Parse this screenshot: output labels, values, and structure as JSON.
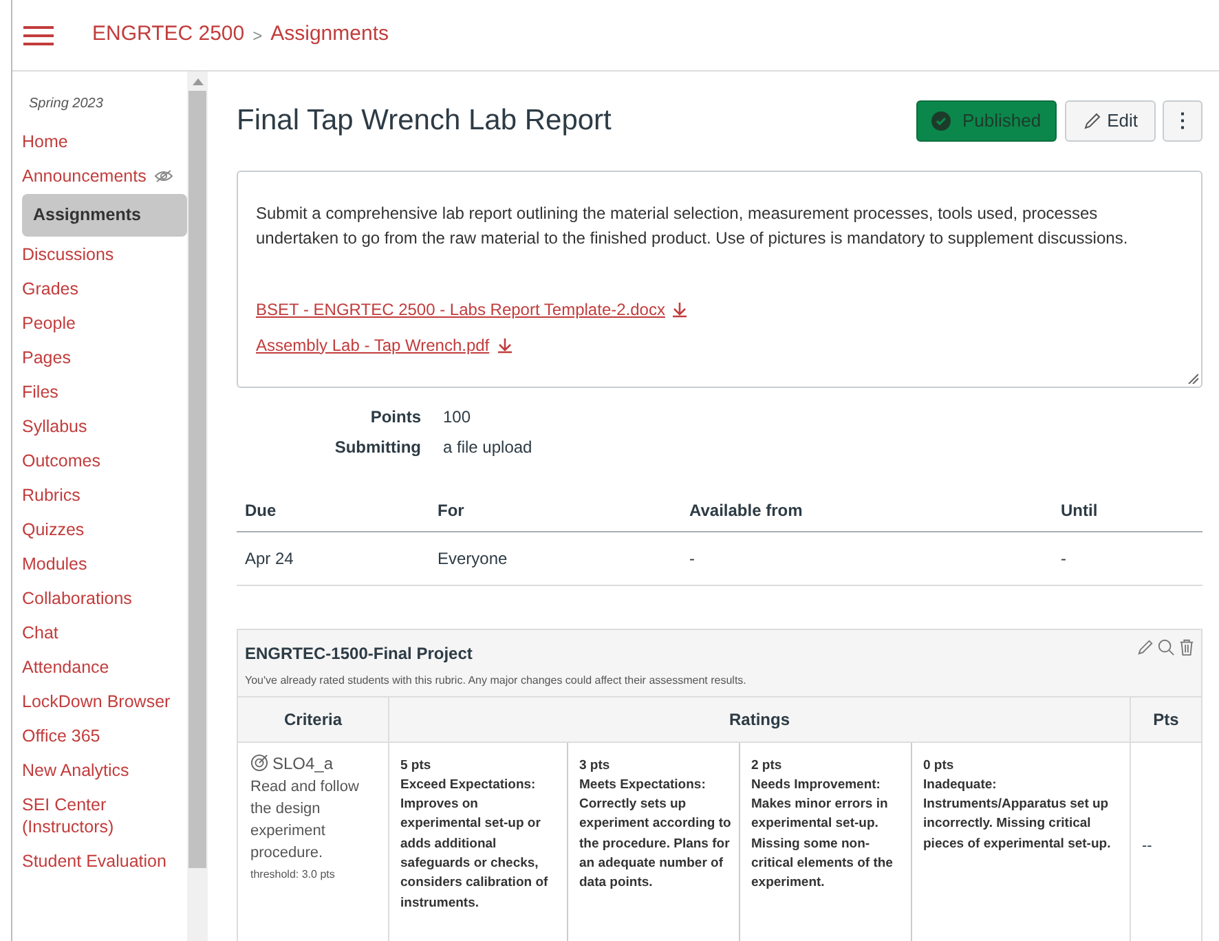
{
  "header": {
    "breadcrumb": [
      "ENGRTEC 2500",
      "Assignments"
    ],
    "separator": ">"
  },
  "sidebar": {
    "term": "Spring 2023",
    "items": [
      {
        "label": "Home",
        "selected": false,
        "hidden": false
      },
      {
        "label": "Announcements",
        "selected": false,
        "hidden": true
      },
      {
        "label": "Assignments",
        "selected": true,
        "hidden": false
      },
      {
        "label": "Discussions",
        "selected": false,
        "hidden": false
      },
      {
        "label": "Grades",
        "selected": false,
        "hidden": false
      },
      {
        "label": "People",
        "selected": false,
        "hidden": false
      },
      {
        "label": "Pages",
        "selected": false,
        "hidden": false
      },
      {
        "label": "Files",
        "selected": false,
        "hidden": false
      },
      {
        "label": "Syllabus",
        "selected": false,
        "hidden": false
      },
      {
        "label": "Outcomes",
        "selected": false,
        "hidden": false
      },
      {
        "label": "Rubrics",
        "selected": false,
        "hidden": false
      },
      {
        "label": "Quizzes",
        "selected": false,
        "hidden": false
      },
      {
        "label": "Modules",
        "selected": false,
        "hidden": false
      },
      {
        "label": "Collaborations",
        "selected": false,
        "hidden": false
      },
      {
        "label": "Chat",
        "selected": false,
        "hidden": false
      },
      {
        "label": "Attendance",
        "selected": false,
        "hidden": false
      },
      {
        "label": "LockDown Browser",
        "selected": false,
        "hidden": false
      },
      {
        "label": "Office 365",
        "selected": false,
        "hidden": false
      },
      {
        "label": "New Analytics",
        "selected": false,
        "hidden": false
      },
      {
        "label": "SEI Center (Instructors)",
        "selected": false,
        "hidden": false
      },
      {
        "label": "Student Evaluation",
        "selected": false,
        "hidden": false
      }
    ]
  },
  "assignment": {
    "title": "Final Tap Wrench Lab Report",
    "published_button": "Published",
    "edit_button": "Edit",
    "more_button": "⋮",
    "description": "Submit a comprehensive lab report outlining the material selection, measurement processes, tools used, processes undertaken to go from the raw material to the finished product. Use of pictures is mandatory to supplement discussions.",
    "attachments": [
      "BSET - ENGRTEC 2500 - Labs Report Template-2.docx",
      "Assembly Lab - Tap Wrench.pdf"
    ],
    "details": [
      {
        "label": "Points",
        "value": "100"
      },
      {
        "label": "Submitting",
        "value": "a file upload"
      }
    ]
  },
  "dates_table": {
    "columns": [
      "Due",
      "For",
      "Available from",
      "Until"
    ],
    "rows": [
      [
        "Apr 24",
        "Everyone",
        "-",
        "-"
      ]
    ]
  },
  "rubric": {
    "title": "ENGRTEC-1500-Final Project",
    "note": "You've already rated students with this rubric. Any major changes could affect their assessment results.",
    "columns": [
      "Criteria",
      "Ratings",
      "Pts"
    ],
    "criteria": [
      {
        "outcome": "SLO4_a",
        "description": "Read and follow the design experiment procedure.",
        "threshold": "threshold: 3.0 pts",
        "pts": "--",
        "ratings": [
          {
            "points": "5 pts",
            "title": "Exceed Expectations:",
            "text": "Improves on experimental set-up or adds additional safeguards or checks, considers calibration of instruments."
          },
          {
            "points": "3 pts",
            "title": "Meets Expectations:",
            "text": "Correctly sets up experiment according to the procedure. Plans for an adequate number of data points."
          },
          {
            "points": "2 pts",
            "title": "Needs Improvement:",
            "text": "Makes minor errors in experimental set-up. Missing some non-critical elements of the experiment."
          },
          {
            "points": "0 pts",
            "title": "Inadequate:",
            "text": "Instruments/Apparatus set up incorrectly. Missing critical pieces of experimental set-up."
          }
        ]
      }
    ]
  }
}
